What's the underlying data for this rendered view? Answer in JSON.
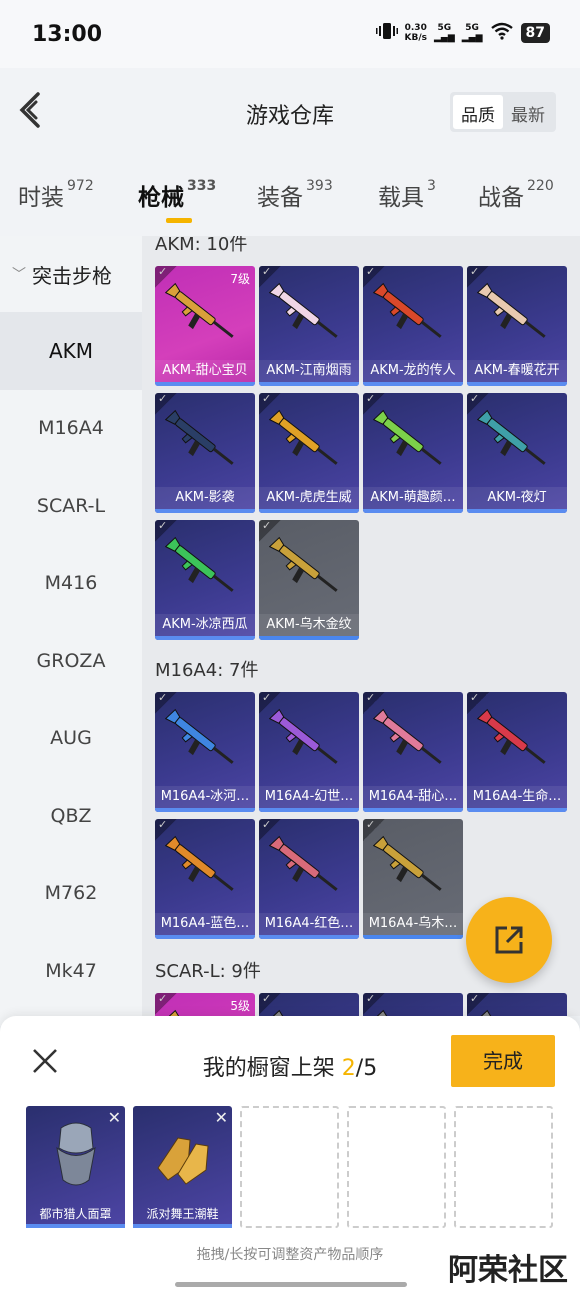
{
  "status": {
    "time": "13:00",
    "net_speed": "0.30",
    "net_unit": "KB/s",
    "sig1": "5G",
    "sig2": "5G",
    "battery": "87"
  },
  "header": {
    "title": "游戏仓库",
    "sort_quality": "品质",
    "sort_new": "最新"
  },
  "tabs": [
    {
      "label": "时装",
      "count": "972"
    },
    {
      "label": "枪械",
      "count": "333"
    },
    {
      "label": "装备",
      "count": "393"
    },
    {
      "label": "载具",
      "count": "3"
    },
    {
      "label": "战备",
      "count": "220"
    }
  ],
  "sidebar": {
    "category": "突击步枪",
    "items": [
      "AKM",
      "M16A4",
      "SCAR-L",
      "M416",
      "GROZA",
      "AUG",
      "QBZ",
      "M762",
      "Mk47"
    ]
  },
  "sections": [
    {
      "title": "AKM: 10件",
      "cards": [
        {
          "name": "AKM-甜心宝贝",
          "grade": "7级",
          "style": "pink",
          "gunColor": "#d9a03a"
        },
        {
          "name": "AKM-江南烟雨",
          "grade": "",
          "style": "blue",
          "gunColor": "#f0d6e6"
        },
        {
          "name": "AKM-龙的传人",
          "grade": "",
          "style": "blue",
          "gunColor": "#d9482a"
        },
        {
          "name": "AKM-春暖花开",
          "grade": "",
          "style": "blue",
          "gunColor": "#e8c9b0"
        },
        {
          "name": "AKM-影袭",
          "grade": "",
          "style": "blue",
          "gunColor": "#2a3e66"
        },
        {
          "name": "AKM-虎虎生威",
          "grade": "",
          "style": "blue",
          "gunColor": "#e0a126"
        },
        {
          "name": "AKM-萌趣颜…",
          "grade": "",
          "style": "blue",
          "gunColor": "#7cd14a"
        },
        {
          "name": "AKM-夜灯",
          "grade": "",
          "style": "blue",
          "gunColor": "#3fa0a8"
        },
        {
          "name": "AKM-冰凉西瓜",
          "grade": "",
          "style": "blue",
          "gunColor": "#3cc35a"
        },
        {
          "name": "AKM-乌木金纹",
          "grade": "",
          "style": "gray",
          "gunColor": "#c9a13a"
        }
      ]
    },
    {
      "title": "M16A4: 7件",
      "cards": [
        {
          "name": "M16A4-冰河…",
          "grade": "",
          "style": "blue",
          "gunColor": "#3f86e0"
        },
        {
          "name": "M16A4-幻世…",
          "grade": "",
          "style": "blue",
          "gunColor": "#9b5ad8"
        },
        {
          "name": "M16A4-甜心…",
          "grade": "",
          "style": "blue",
          "gunColor": "#e07a9a"
        },
        {
          "name": "M16A4-生命…",
          "grade": "",
          "style": "blue",
          "gunColor": "#d83a4a"
        },
        {
          "name": "M16A4-蓝色…",
          "grade": "",
          "style": "blue",
          "gunColor": "#e08a2a"
        },
        {
          "name": "M16A4-红色…",
          "grade": "",
          "style": "blue",
          "gunColor": "#d86a7a"
        },
        {
          "name": "M16A4-乌木…",
          "grade": "",
          "style": "gray",
          "gunColor": "#c9a13a"
        }
      ]
    },
    {
      "title": "SCAR-L: 9件",
      "cards": [
        {
          "name": "",
          "grade": "5级",
          "style": "pink",
          "gunColor": "#d9a03a"
        },
        {
          "name": "",
          "grade": "",
          "style": "blue",
          "gunColor": "#888"
        },
        {
          "name": "",
          "grade": "",
          "style": "blue",
          "gunColor": "#888"
        },
        {
          "name": "",
          "grade": "",
          "style": "blue",
          "gunColor": "#888"
        }
      ]
    }
  ],
  "sheet": {
    "title_prefix": "我的橱窗上架",
    "count_current": "2",
    "count_total": "/5",
    "done_label": "完成",
    "slots": [
      {
        "name": "都市猎人面罩",
        "filled": true,
        "kind": "mask"
      },
      {
        "name": "派对舞王潮鞋",
        "filled": true,
        "kind": "shoes"
      },
      {
        "name": "",
        "filled": false
      },
      {
        "name": "",
        "filled": false
      },
      {
        "name": "",
        "filled": false
      }
    ],
    "hint": "拖拽/长按可调整资产物品顺序"
  },
  "watermark": "阿荣社区"
}
